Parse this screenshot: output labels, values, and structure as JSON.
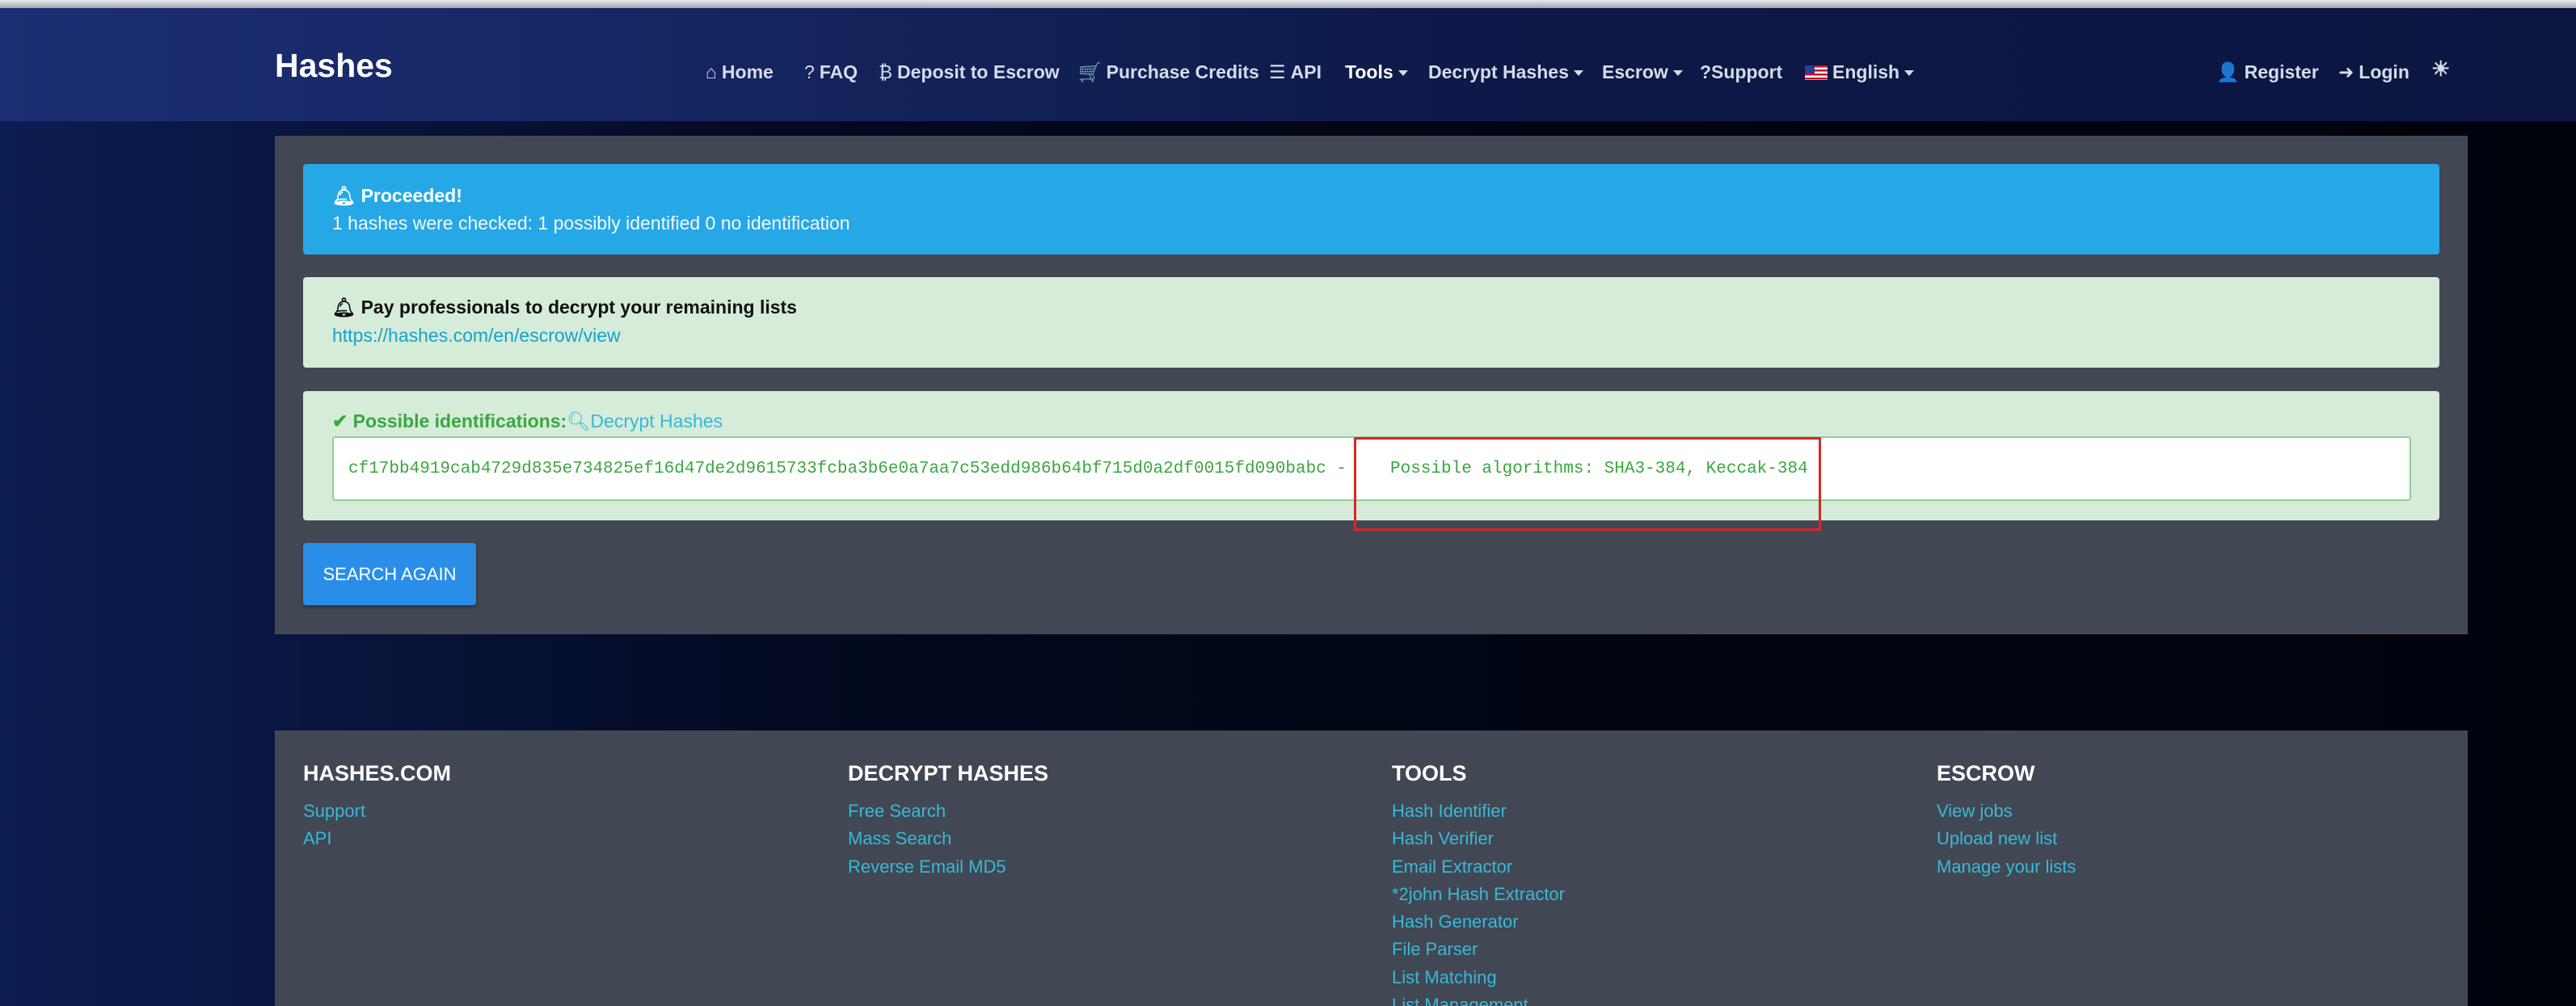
{
  "nav": {
    "brand": "Hashes",
    "items": {
      "home": "Home",
      "faq": "FAQ",
      "deposit": "Deposit to Escrow",
      "purchase": "Purchase Credits",
      "api": "API",
      "tools": "Tools",
      "decrypt": "Decrypt Hashes",
      "escrow": "Escrow",
      "support": "?Support",
      "english": "English",
      "register": "Register",
      "login": "Login"
    }
  },
  "alerts": {
    "proceeded": {
      "title": "Proceeded!",
      "text": "1 hashes were checked: 1 possibly identified 0 no identification"
    },
    "pay": {
      "title": "Pay professionals to decrypt your remaining lists",
      "link": "https://hashes.com/en/escrow/view"
    },
    "possible": {
      "title": "Possible identifications:",
      "link": "Decrypt Hashes",
      "hash": "cf17bb4919cab4729d835e734825ef16d47de2d9615733fcba3b6e0a7aa7c53edd986b64bf715d0a2df0015fd090babc -",
      "algorithms": "Possible algorithms: SHA3-384, Keccak-384"
    }
  },
  "search_again": "SEARCH AGAIN",
  "footer": {
    "hashes_com": {
      "heading": "HASHES.COM",
      "links": [
        "Support",
        "API"
      ]
    },
    "decrypt_hashes": {
      "heading": "DECRYPT HASHES",
      "links": [
        "Free Search",
        "Mass Search",
        "Reverse Email MD5"
      ]
    },
    "tools": {
      "heading": "TOOLS",
      "links": [
        "Hash Identifier",
        "Hash Verifier",
        "Email Extractor",
        "*2john Hash Extractor",
        "Hash Generator",
        "File Parser",
        "List Matching",
        "List Management"
      ]
    },
    "escrow": {
      "heading": "ESCROW",
      "links": [
        "View jobs",
        "Upload new list",
        "Manage your lists"
      ]
    }
  },
  "colors": {
    "info_alert": "#27a8e6",
    "success_alert": "#d5ecd9",
    "success_text": "#3aa73f",
    "link": "#38b8d8",
    "highlight_border": "#d62828"
  },
  "icons": [
    "home-icon",
    "faq-icon",
    "bitcoin-icon",
    "cart-icon",
    "server-icon",
    "us-flag-icon",
    "user-plus-icon",
    "sign-in-icon",
    "sun-icon",
    "bell-icon",
    "check-icon",
    "search-icon"
  ]
}
